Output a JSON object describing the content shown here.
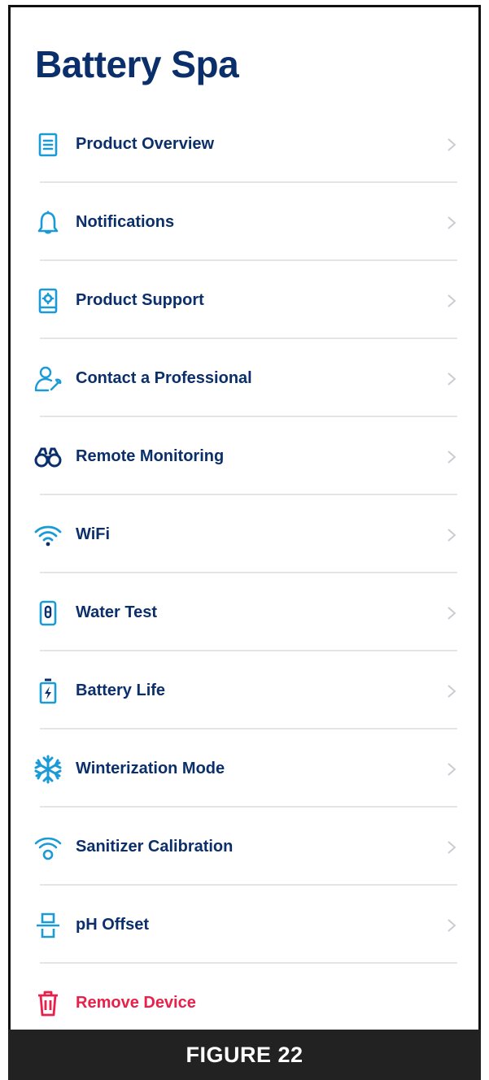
{
  "app": {
    "title": "Battery Spa"
  },
  "colors": {
    "accent": "#1a9ad6",
    "text": "#0b2f6b",
    "danger": "#e8204a"
  },
  "menu": {
    "items": [
      {
        "label": "Product Overview",
        "icon": "document-icon"
      },
      {
        "label": "Notifications",
        "icon": "bell-icon"
      },
      {
        "label": "Product Support",
        "icon": "support-device-icon"
      },
      {
        "label": "Contact a Professional",
        "icon": "professional-icon"
      },
      {
        "label": "Remote Monitoring",
        "icon": "binoculars-icon"
      },
      {
        "label": "WiFi",
        "icon": "wifi-icon"
      },
      {
        "label": "Water Test",
        "icon": "test-strip-icon"
      },
      {
        "label": "Battery Life",
        "icon": "battery-icon"
      },
      {
        "label": "Winterization Mode",
        "icon": "snowflake-icon"
      },
      {
        "label": "Sanitizer Calibration",
        "icon": "calibration-icon"
      },
      {
        "label": "pH Offset",
        "icon": "ph-offset-icon"
      },
      {
        "label": "Remove Device",
        "icon": "trash-icon"
      }
    ]
  },
  "caption": "FIGURE 22"
}
